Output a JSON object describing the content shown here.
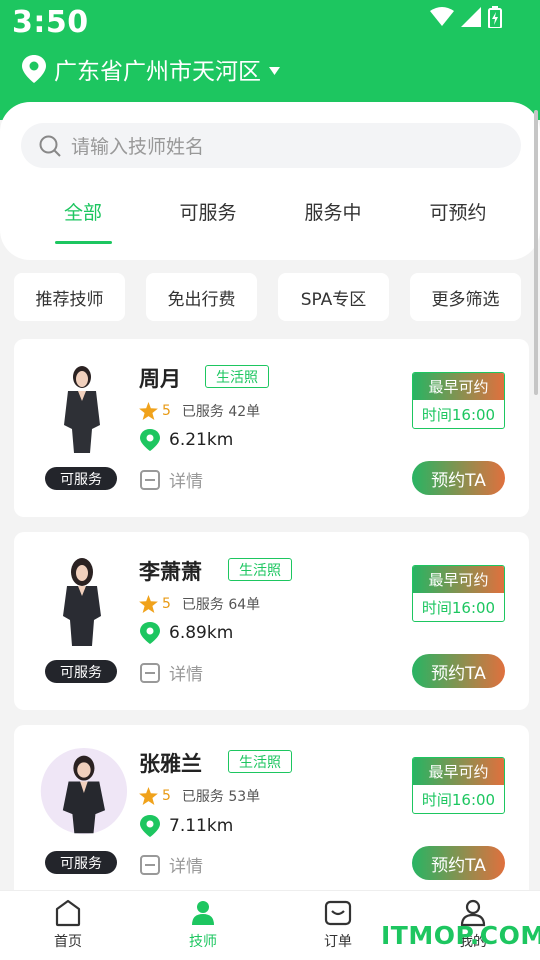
{
  "status_bar": {
    "time": "3:50"
  },
  "location": {
    "text": "广东省广州市天河区"
  },
  "search": {
    "placeholder": "请输入技师姓名"
  },
  "tabs": [
    {
      "label": "全部",
      "active": true
    },
    {
      "label": "可服务",
      "active": false
    },
    {
      "label": "服务中",
      "active": false
    },
    {
      "label": "可预约",
      "active": false
    }
  ],
  "filters": [
    "推荐技师",
    "免出行费",
    "SPA专区",
    "更多筛选"
  ],
  "technicians": [
    {
      "name": "周月",
      "tag": "生活照",
      "rating": "5",
      "served": "已服务 42单",
      "distance": "6.21km",
      "status": "可服务",
      "detail": "详情",
      "avail_label": "最早可约",
      "avail_time": "时间16:00",
      "book_label": "预约TA"
    },
    {
      "name": "李萧萧",
      "tag": "生活照",
      "rating": "5",
      "served": "已服务 64单",
      "distance": "6.89km",
      "status": "可服务",
      "detail": "详情",
      "avail_label": "最早可约",
      "avail_time": "时间16:00",
      "book_label": "预约TA"
    },
    {
      "name": "张雅兰",
      "tag": "生活照",
      "rating": "5",
      "served": "已服务 53单",
      "distance": "7.11km",
      "status": "可服务",
      "detail": "详情",
      "avail_label": "最早可约",
      "avail_time": "时间16:00",
      "book_label": "预约TA"
    }
  ],
  "bottom_nav": [
    {
      "label": "首页",
      "icon": "home-icon",
      "active": false
    },
    {
      "label": "技师",
      "icon": "technician-icon",
      "active": true
    },
    {
      "label": "订单",
      "icon": "order-icon",
      "active": false
    },
    {
      "label": "我的",
      "icon": "profile-icon",
      "active": false
    }
  ],
  "watermark": "ITMOP.COM",
  "colors": {
    "brand_green": "#1dc660",
    "gradient_end": "#e0703e",
    "pill_dark": "#23252b"
  }
}
